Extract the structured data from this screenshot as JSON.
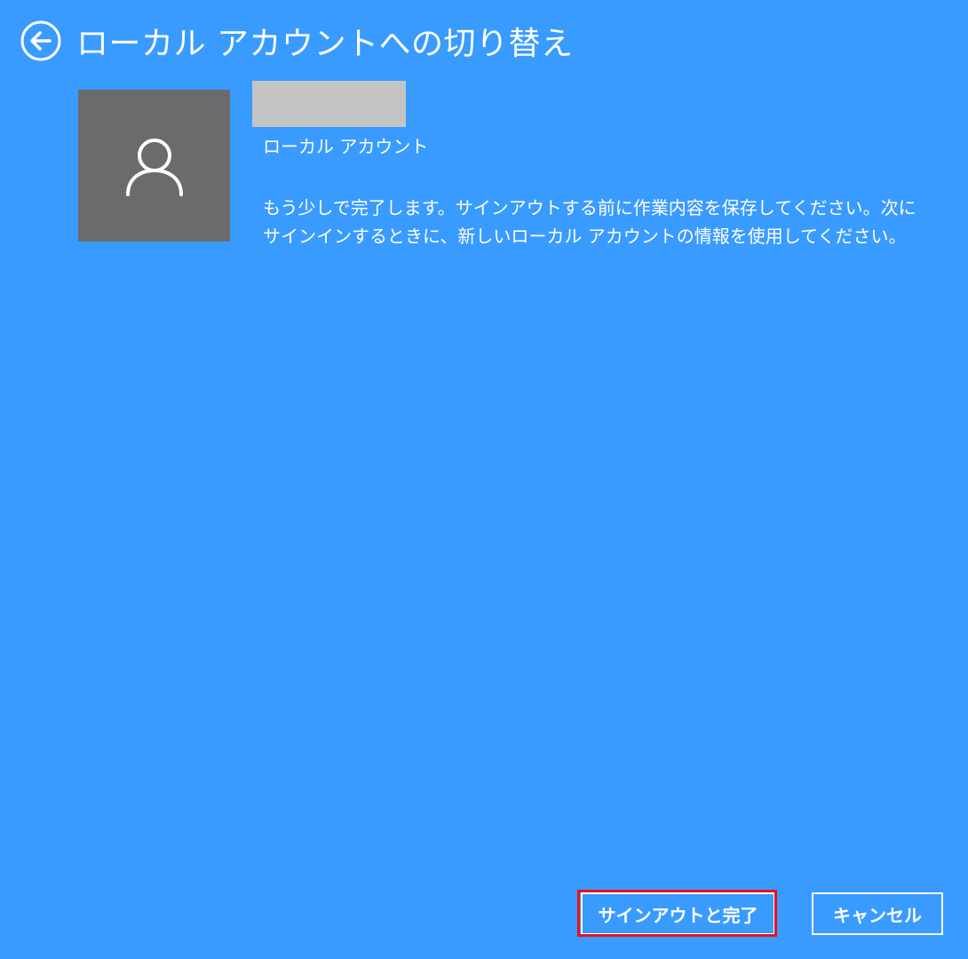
{
  "header": {
    "title": "ローカル アカウントへの切り替え",
    "back_icon": "back-arrow-circle-icon"
  },
  "account": {
    "avatar_icon": "user-icon",
    "name": "",
    "type_label": "ローカル アカウント"
  },
  "message": "もう少しで完了します。サインアウトする前に作業内容を保存してください。次にサインインするときに、新しいローカル アカウントの情報を使用してください。",
  "buttons": {
    "signout_finish": "サインアウトと完了",
    "cancel": "キャンセル"
  },
  "colors": {
    "background": "#3a9bff",
    "avatar_bg": "#6b6b6b",
    "highlight": "#e8101c"
  }
}
